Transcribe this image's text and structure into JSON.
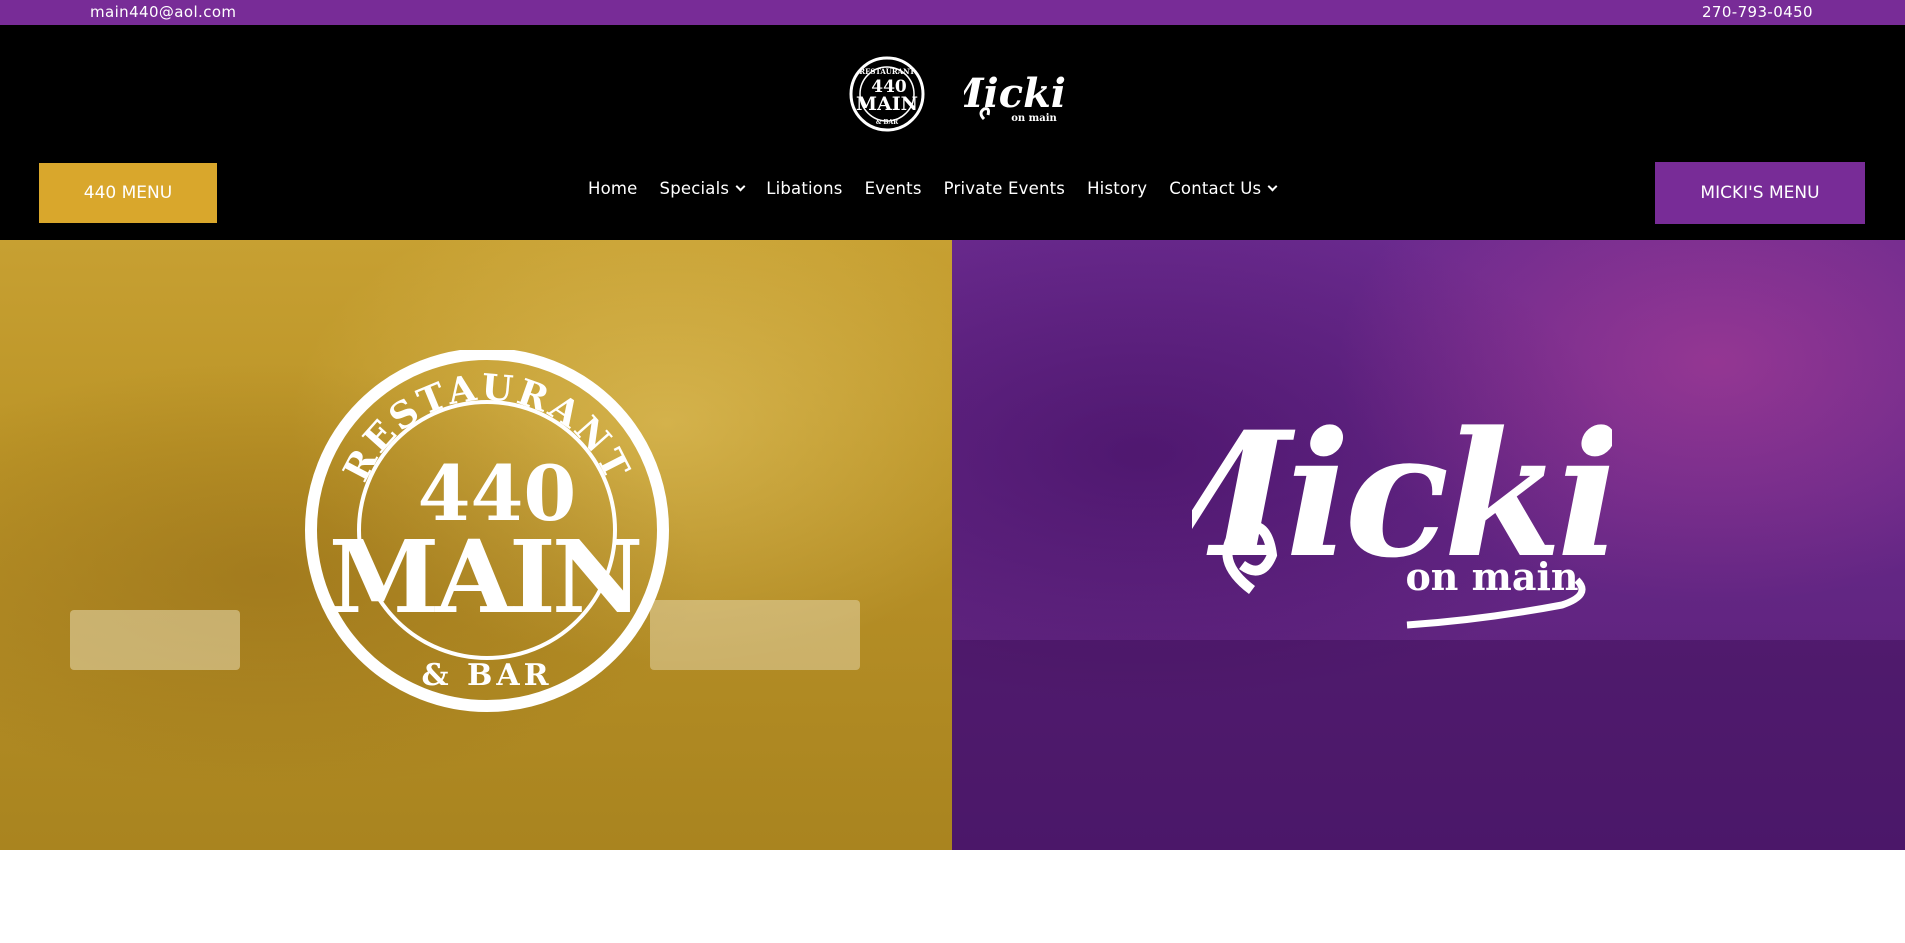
{
  "topbar": {
    "email": "main440@aol.com",
    "phone": "270-793-0450"
  },
  "header": {
    "logos": {
      "restaurant_logo": {
        "top_text": "RESTAURANT",
        "number": "440",
        "name": "MAIN",
        "bottom_text": "& BAR"
      },
      "mickis_logo": {
        "name": "Micki's",
        "tagline": "on main"
      }
    },
    "buttons": {
      "menu_440": "440 MENU",
      "menu_mickis": "MICKI'S MENU"
    },
    "nav": [
      {
        "label": "Home",
        "has_dropdown": false
      },
      {
        "label": "Specials",
        "has_dropdown": true
      },
      {
        "label": "Libations",
        "has_dropdown": false
      },
      {
        "label": "Events",
        "has_dropdown": false
      },
      {
        "label": "Private Events",
        "has_dropdown": false
      },
      {
        "label": "History",
        "has_dropdown": false
      },
      {
        "label": "Contact Us",
        "has_dropdown": true
      }
    ]
  },
  "hero": {
    "left": {
      "overlay_color": "#c9a12e"
    },
    "right": {
      "overlay_color": "#6a2a8e"
    }
  },
  "colors": {
    "brand_purple": "#782c97",
    "brand_gold": "#d9a72c",
    "header_bg": "#000000"
  }
}
